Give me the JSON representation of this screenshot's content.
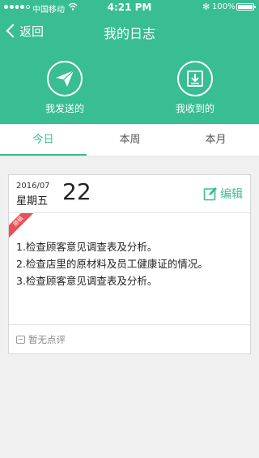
{
  "status_bar": {
    "carrier": "中国移动",
    "time": "4:21 PM",
    "battery": "100%",
    "bluetooth_glyph": "✻",
    "battery_level": 1.0
  },
  "nav": {
    "back_label": "返回",
    "title": "我的日志"
  },
  "actions": {
    "sent_label": "我发送的",
    "received_label": "我收到的"
  },
  "tabs": [
    {
      "label": "今日",
      "active": true
    },
    {
      "label": "本周",
      "active": false
    },
    {
      "label": "本月",
      "active": false
    }
  ],
  "log": {
    "year_month": "2016/07",
    "weekday": "星期五",
    "day": "22",
    "edit_label": "编辑",
    "ribbon": "原稿",
    "items": [
      "1.检查顾客意见调查表及分析。",
      "2.检查店里的原材料及员工健康证的情况。",
      "3.检查顾客意见调查表及分析。"
    ],
    "comment_placeholder": "暂无点评"
  },
  "colors": {
    "accent": "#39bd93",
    "ribbon": "#e8505b"
  },
  "icons": {
    "back": "chevron-left-icon",
    "send": "paper-plane-icon",
    "receive": "download-icon",
    "edit": "edit-icon",
    "comment": "comment-icon"
  }
}
